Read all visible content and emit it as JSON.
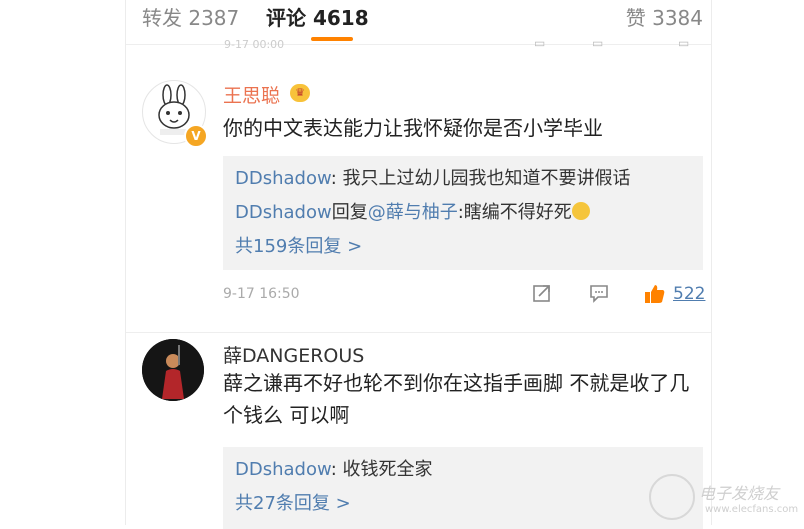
{
  "tabs": {
    "repost": {
      "label": "转发",
      "count": "2387"
    },
    "comment": {
      "label": "评论",
      "count": "4618"
    },
    "like": {
      "label": "赞",
      "count": "3384"
    }
  },
  "strip": {
    "time": "9-17 00:00"
  },
  "comments": [
    {
      "username": "王思聪",
      "text": "你的中文表达能力让我怀疑你是否小学毕业",
      "replies": [
        {
          "name": "DDshadow",
          "sep": ": ",
          "text": "我只上过幼儿园我也知道不要讲假话"
        },
        {
          "name": "DDshadow",
          "mid": "回复",
          "at": "@薛与柚子",
          "text": ":瞎编不得好死"
        }
      ],
      "more": "共159条回复 >",
      "time": "9-17 16:50",
      "likes": "522"
    },
    {
      "username": "薛DANGEROUS",
      "text": "薛之谦再不好也轮不到你在这指手画脚  不就是收了几个钱么  可以啊",
      "replies": [
        {
          "name": "DDshadow",
          "sep": ": ",
          "text": "收钱死全家"
        }
      ],
      "more": "共27条回复 >"
    }
  ],
  "watermark": {
    "text": "电子发烧友",
    "url": "www.elecfans.com"
  },
  "colors": {
    "accent": "#ff8200",
    "link": "#507daf",
    "vip_name": "#eb7350",
    "like": "#ff8200"
  }
}
